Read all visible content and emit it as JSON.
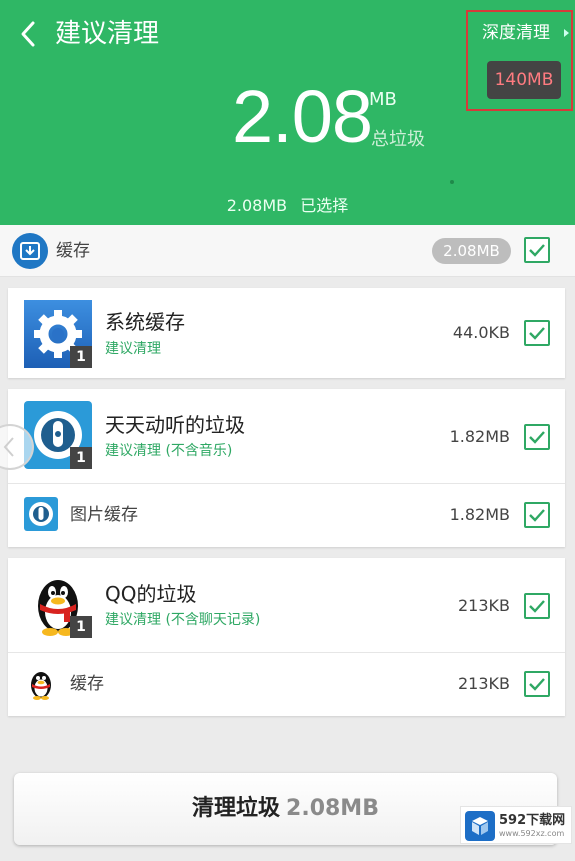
{
  "header": {
    "title": "建议清理",
    "deep_clean_label": "深度清理",
    "deep_clean_size": "140MB",
    "total_size": "2.08",
    "total_unit": "MB",
    "total_label": "总垃圾",
    "selected_size": "2.08MB",
    "selected_label": "已选择"
  },
  "category": {
    "label": "缓存",
    "size": "2.08MB",
    "checked": true
  },
  "groups": [
    {
      "name": "系统缓存",
      "note": "建议清理",
      "size": "44.0KB",
      "badge": "1",
      "icon": "gear-icon",
      "checked": true
    },
    {
      "name": "天天动听的垃圾",
      "note": "建议清理 (不含音乐)",
      "size": "1.82MB",
      "badge": "1",
      "icon": "music-player-icon",
      "checked": true,
      "sub": {
        "label": "图片缓存",
        "size": "1.82MB",
        "icon": "music-player-small-icon",
        "checked": true
      }
    },
    {
      "name": "QQ的垃圾",
      "note": "建议清理 (不含聊天记录)",
      "size": "213KB",
      "badge": "1",
      "icon": "qq-penguin-icon",
      "checked": true,
      "sub": {
        "label": "缓存",
        "size": "213KB",
        "icon": "qq-penguin-small-icon",
        "checked": true
      }
    }
  ],
  "clean_button": {
    "label": "清理垃圾",
    "size": "2.08MB"
  },
  "watermark": {
    "text": "592下载网",
    "sub": "www.592xz.com"
  },
  "colors": {
    "header_green": "#2fb765",
    "accent_green": "#2fa864",
    "highlight_red": "#d63a3a"
  }
}
